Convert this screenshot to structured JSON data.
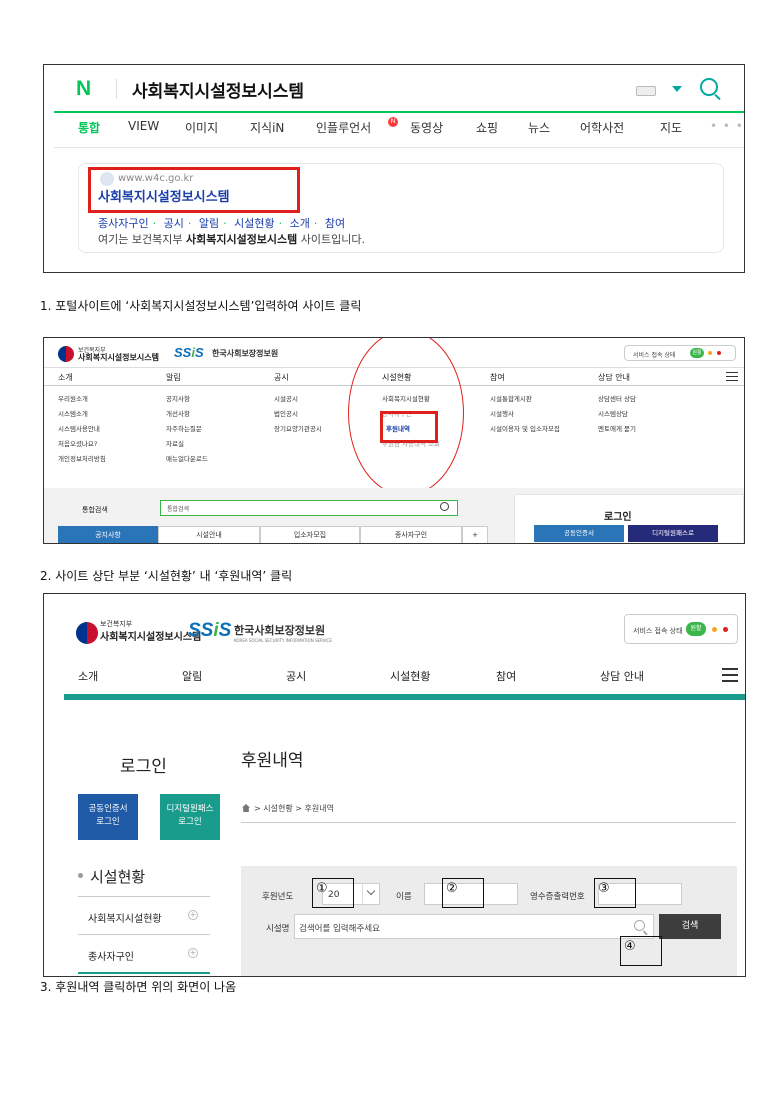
{
  "panel1": {
    "logo": "N",
    "query": "사회복지시설정보시스템",
    "tabs": [
      "통합",
      "VIEW",
      "이미지",
      "지식iN",
      "인플루언서",
      "동영상",
      "쇼핑",
      "뉴스",
      "어학사전",
      "지도"
    ],
    "more": "• • •",
    "badge": "N",
    "result": {
      "url": "www.w4c.go.kr",
      "title": "사회복지시설정보시스템",
      "links": [
        "종사자구인",
        "공시",
        "알림",
        "시설현황",
        "소개",
        "참여"
      ],
      "desc_prefix": "여기는 보건복지부",
      "desc_bold": "사회복지시설정보시스템",
      "desc_suffix": "사이트입니다."
    }
  },
  "caption1": "1.  포털사이트에 ‘사회복지시설정보시스템’입력하여 사이트 클릭",
  "panel2": {
    "ministry": "보건복지부",
    "system_name": "사회복지시설정보시스템",
    "ssis_logo": "SSiS",
    "ssis_name": "한국사회보장정보원",
    "status_label": "서비스 접속 상태",
    "status_value": "원활",
    "menu": [
      "소개",
      "알림",
      "공시",
      "시설현황",
      "참여",
      "상담 안내"
    ],
    "submenus": [
      [
        "우리원소개",
        "시스템소개",
        "시스템사용안내",
        "처음오셨나요?",
        "개인정보처리방침"
      ],
      [
        "공지사항",
        "개선사항",
        "자주하는질문",
        "자료실",
        "매뉴얼다운로드"
      ],
      [
        "시설공시",
        "법인공시",
        "장기요양기관공시"
      ],
      [
        "사회복지시설현황",
        "종사자구인",
        "후원내역",
        "후원금 사용내역 조회"
      ],
      [
        "시설통합게시판",
        "시설행사",
        "시설이용자 및 입소자모집"
      ],
      [
        "상담센터 상담",
        "시스템상담",
        "멘토에게 묻기"
      ]
    ],
    "search_label": "통합검색",
    "search_placeholder": "통합검색",
    "tabs": [
      "공지사항",
      "시설안내",
      "입소자모집",
      "종사자구인",
      "+"
    ],
    "login_title": "로그인",
    "login_buttons": [
      "공동인증서",
      "디지털원패스로"
    ]
  },
  "caption2": "2.  사이트 상단 부분 ‘시설현황’ 내 ‘후원내역’ 클릭",
  "panel3": {
    "ministry": "보건복지부",
    "system_name": "사회복지시설정보시스템",
    "ssis_logo": "SSiS",
    "ssis_name": "한국사회보장정보원",
    "ssis_sub": "KOREA SOCIAL SECURITY INFORMATION SERVICE",
    "status_label": "서비스 접속 상태",
    "status_value": "원활",
    "menu": [
      "소개",
      "알림",
      "공시",
      "시설현황",
      "참여",
      "상담 안내"
    ],
    "login_title": "로그인",
    "login_buttons": [
      {
        "line1": "공동인증서",
        "line2": "로그인"
      },
      {
        "line1": "디지털원패스",
        "line2": "로그인"
      }
    ],
    "side_title": "시설현황",
    "side_items": [
      "사회복지시설현황",
      "종사자구인"
    ],
    "page_title": "후원내역",
    "breadcrumb": "> 시설현황 > 후원내역",
    "form": {
      "year_label": "후원년도",
      "year_value": "20",
      "name_label": "이름",
      "receipt_label": "영수증출력번호",
      "facility_label": "시설명",
      "facility_placeholder": "검색어를 입력해주세요",
      "search_button": "검색"
    },
    "markers": [
      "①",
      "②",
      "③",
      "④"
    ]
  },
  "caption3": "3.  후원내역 클릭하면 위의 화면이 나옴",
  "colors": {
    "naver_green": "#03c75a",
    "highlight_red": "#e0201b",
    "teal": "#1a9c8c",
    "link_blue": "#1a3da8",
    "ssis_blue": "#0d6fb8"
  }
}
